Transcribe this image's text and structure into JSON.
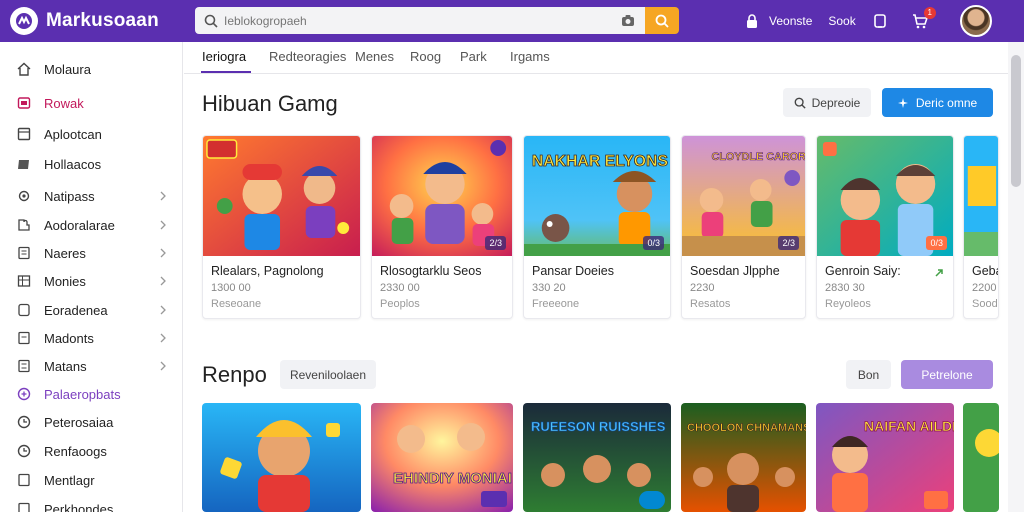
{
  "app": {
    "logo_text": "Markusoaan"
  },
  "search": {
    "placeholder": "Ieblokogropaeh"
  },
  "topnav": {
    "account_label": "Veonste",
    "extra_label": "Sook",
    "cart_count": "1"
  },
  "sidebar": {
    "items": [
      {
        "label": "Molaura",
        "icon": "home-icon"
      },
      {
        "label": "Rowak",
        "icon": "heart-icon"
      },
      {
        "label": "Aplootcan",
        "icon": "grid-icon"
      },
      {
        "label": "Hollaacos",
        "icon": "tag-icon"
      },
      {
        "label": "Natipass",
        "icon": "gear-icon"
      },
      {
        "label": "Aodoralarae",
        "icon": "puzzle-icon"
      },
      {
        "label": "Naeres",
        "icon": "doc-icon"
      },
      {
        "label": "Monies",
        "icon": "table-icon"
      },
      {
        "label": "Eoradenea",
        "icon": "doc-icon"
      },
      {
        "label": "Madonts",
        "icon": "doc-icon"
      },
      {
        "label": "Matans",
        "icon": "doc-icon"
      },
      {
        "label": "Palaeropbats",
        "icon": "gamepad-icon"
      },
      {
        "label": "Peterosaiaa",
        "icon": "clock-icon"
      },
      {
        "label": "Renfaoogs",
        "icon": "clock-icon"
      },
      {
        "label": "Mentlagr",
        "icon": "doc-icon"
      },
      {
        "label": "Perkhondes",
        "icon": "doc-icon"
      }
    ]
  },
  "tabs": [
    "Ieriogra",
    "Redteoragies",
    "Menes",
    "Roog",
    "Park",
    "Irgams"
  ],
  "section1": {
    "title": "Hibuan Gamg",
    "secondary_button": "Depreoie",
    "primary_button": "Deric omne",
    "cards": [
      {
        "title": "Rlealars, Pagnolong",
        "price": "1300 00",
        "meta": "Reseoane"
      },
      {
        "title": "Rlosogtarklu Seos",
        "price": "2330 00",
        "meta": "Peoplos"
      },
      {
        "title": "Pansar Doeies",
        "price": "330 20",
        "meta": "Freeeone",
        "art_text": "NAKHAR ELYONS"
      },
      {
        "title": "Soesdan Jlpphe",
        "price": "2230",
        "meta": "Resatos",
        "art_text": "CLOYDLE CARORN"
      },
      {
        "title": "Genroin Saiy:",
        "price": "2830 30",
        "meta": "Reyoleos"
      },
      {
        "title": "Geba",
        "price": "2200",
        "meta": "Sood"
      }
    ]
  },
  "section2": {
    "title": "Renpo",
    "chip": "Reveniloolaen",
    "secondary_button": "Bon",
    "primary_button": "Petrelone",
    "art_texts": [
      "",
      "EHINDIY MONIAI",
      "RUEESON RUISSHES",
      "CHOOLON CHNAMANS",
      "NAIFAN AILDIG",
      ""
    ]
  },
  "colors": {
    "brand": "#5b2fb0",
    "accent_orange": "#f6a623",
    "accent_blue": "#1e88e5"
  }
}
